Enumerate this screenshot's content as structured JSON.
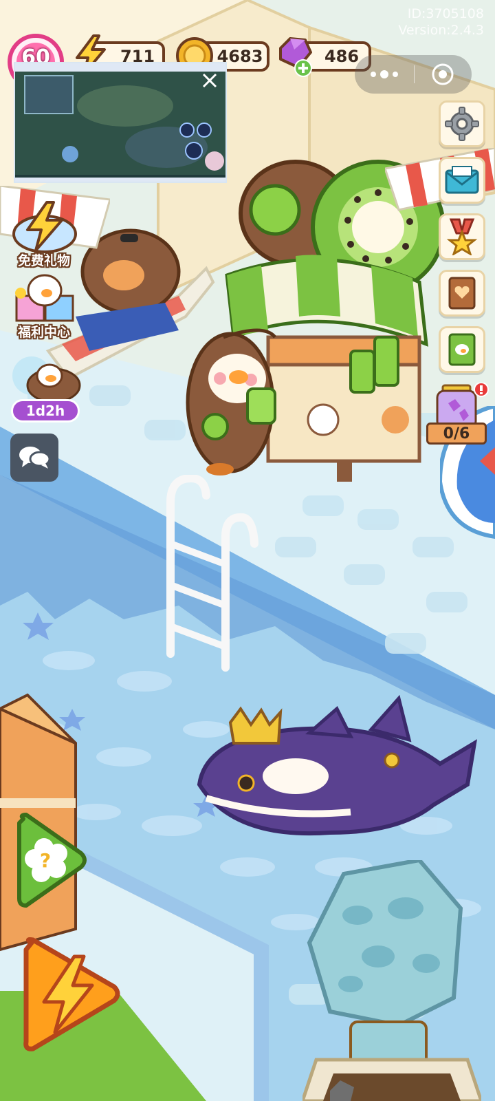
{
  "header": {
    "id_text": "ID:3705108",
    "version_text": "Version:2.4.3"
  },
  "player": {
    "level": "60"
  },
  "resources": {
    "energy": "711",
    "coins": "4683",
    "gems": "486"
  },
  "left_menu": {
    "free_gift_label": "免费礼物",
    "welfare_label": "福利中心",
    "event_timer": "1d2h"
  },
  "right_menu": {
    "collection_counter": "0/6"
  },
  "icons": {
    "settings": "gear-icon",
    "mail": "mail-icon",
    "medal": "medal-star-icon",
    "book": "heart-book-icon",
    "guide": "guide-book-icon",
    "chat": "chat-bubbles-icon",
    "help": "question-flower-icon",
    "boost": "lightning-icon",
    "close": "close-icon"
  },
  "colors": {
    "brown_outline": "#6b3b1f",
    "gem_purple": "#b15ad8",
    "coin_gold": "#f2b428",
    "energy_yellow": "#ffd23a",
    "grass_green": "#7cc242",
    "pool_blue": "#a9d4ee"
  }
}
